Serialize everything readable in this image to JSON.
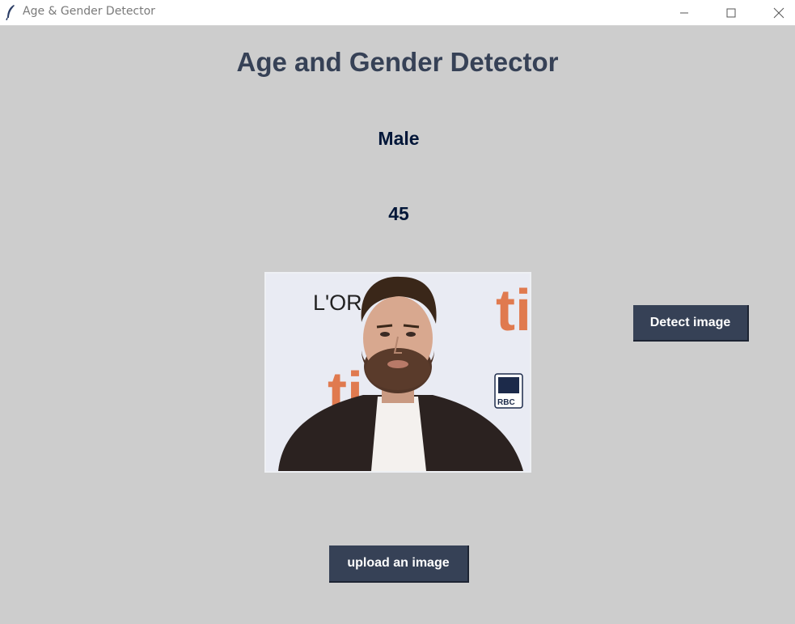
{
  "window": {
    "title": "Age & Gender Detector",
    "controls": [
      "minimize-icon",
      "maximize-icon",
      "close-icon"
    ]
  },
  "app": {
    "heading": "Age and Gender Detector",
    "result_gender": "Male",
    "result_age": "45"
  },
  "image": {
    "logo_text": "L'OR",
    "sponsor_text": "RBC",
    "banner_text": "ti"
  },
  "buttons": {
    "detect_label": "Detect image",
    "upload_label": "upload an image"
  },
  "colors": {
    "background": "#cdcdcd",
    "heading": "#364156",
    "result_text": "#011638",
    "button_bg": "#364156",
    "button_text": "#ffffff"
  }
}
